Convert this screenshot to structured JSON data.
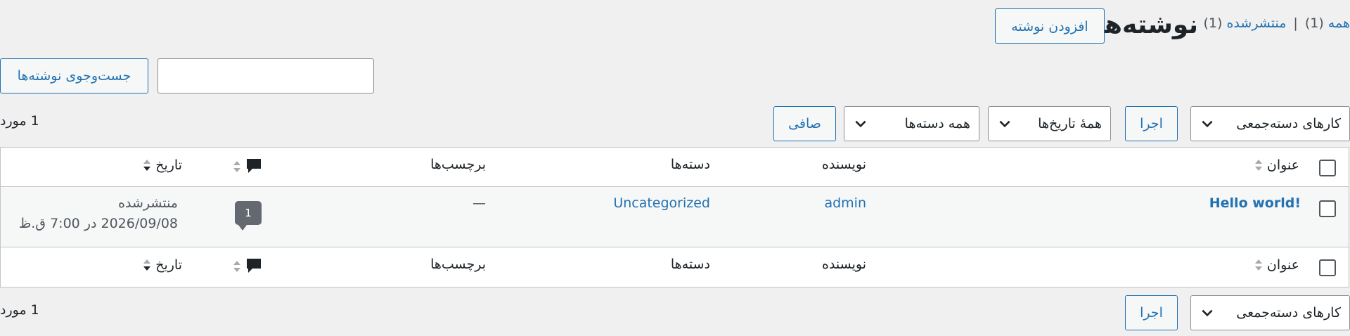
{
  "header": {
    "title": "نوشته‌ها",
    "add_new_label": "افزودن نوشته",
    "filters": {
      "all_label": "همه",
      "all_count": "(1)",
      "separator": "|",
      "published_label": "منتشرشده",
      "published_count": "(1)"
    }
  },
  "search": {
    "input_value": "",
    "button_label": "جست‌وجوی نوشته‌ها"
  },
  "tablenav_top": {
    "bulk_actions": "کارهای دسته‌جمعی",
    "apply_label": "اجرا",
    "dates": "همهٔ تاریخ‌ها",
    "categories": "همه دسته‌ها",
    "filter_label": "صافی",
    "items_count": "1 مورد"
  },
  "tablenav_bottom": {
    "bulk_actions": "کارهای دسته‌جمعی",
    "apply_label": "اجرا",
    "items_count": "1 مورد"
  },
  "columns": {
    "title": "عنوان",
    "author": "نویسنده",
    "categories": "دسته‌ها",
    "tags": "برچسب‌ها",
    "date": "تاریخ"
  },
  "posts": [
    {
      "title": "Hello world!",
      "author": "admin",
      "category": "Uncategorized",
      "tags": "—",
      "comments": "1",
      "status": "منتشرشده",
      "date": "2026/09/08 در 7:00 ق.ظ"
    }
  ],
  "colors": {
    "accent": "#2271b1",
    "background": "#f0f0f1",
    "text": "#1d2327",
    "bubble": "#646970"
  },
  "icons": [
    "comment-bubble-icon",
    "sort-arrows-icon",
    "chevron-down-icon"
  ]
}
